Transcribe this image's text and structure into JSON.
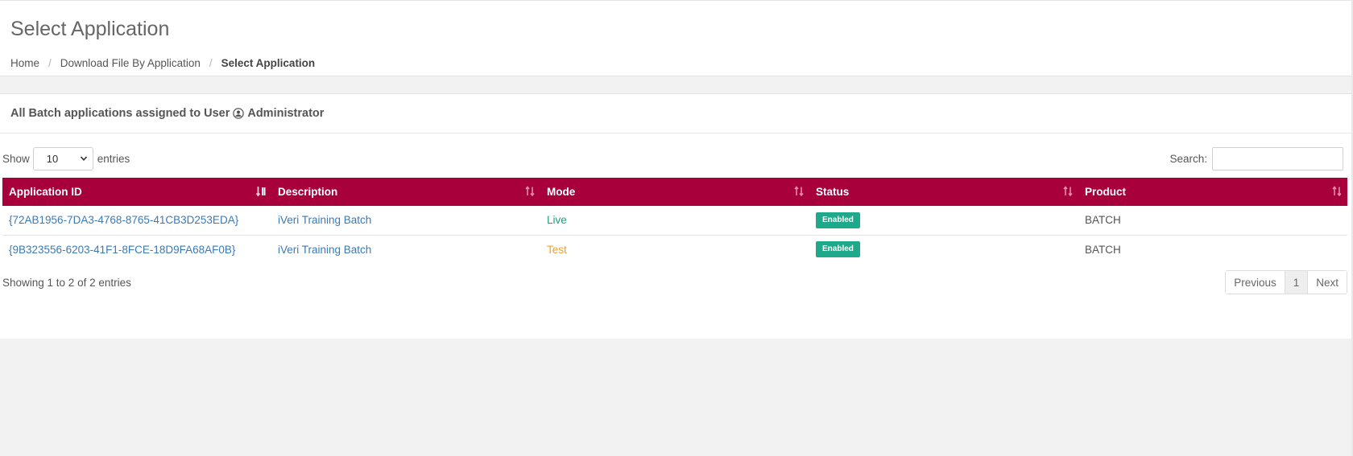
{
  "header": {
    "title": "Select Application",
    "breadcrumb": [
      "Home",
      "Download File By Application",
      "Select Application"
    ]
  },
  "panel": {
    "heading_prefix": "All Batch applications assigned to User",
    "heading_user": "Administrator"
  },
  "controls": {
    "show_label": "Show",
    "page_size": "10",
    "entries_label": "entries",
    "search_label": "Search:",
    "search_value": ""
  },
  "table": {
    "columns": [
      "Application ID",
      "Description",
      "Mode",
      "Status",
      "Product"
    ],
    "rows": [
      {
        "application_id": "{72AB1956-7DA3-4768-8765-41CB3D253EDA}",
        "description": "iVeri Training Batch",
        "mode": "Live",
        "status": "Enabled",
        "product": "BATCH"
      },
      {
        "application_id": "{9B323556-6203-41F1-8FCE-18D9FA68AF0B}",
        "description": "iVeri Training Batch",
        "mode": "Test",
        "status": "Enabled",
        "product": "BATCH"
      }
    ]
  },
  "footer": {
    "info": "Showing 1 to 2 of 2 entries",
    "previous": "Previous",
    "current_page": "1",
    "next": "Next"
  },
  "colors": {
    "header_bg": "#a8003a",
    "link": "#3a7ab8",
    "live": "#1aa37a",
    "test": "#f0a030",
    "badge": "#1eaa8a"
  },
  "icons": {
    "user": "user-circle-icon",
    "sort": "sort-icon",
    "dropdown": "chevron-down-icon"
  }
}
